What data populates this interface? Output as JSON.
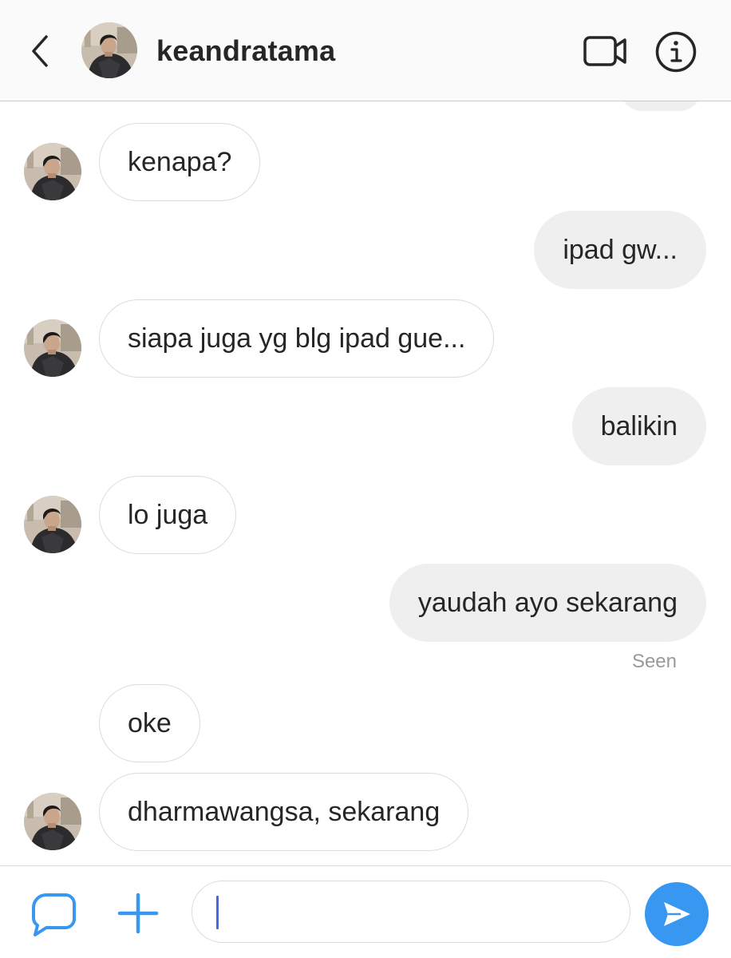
{
  "header": {
    "username": "keandratama",
    "back_icon": "chevron-left-icon",
    "video_icon": "video-camera-icon",
    "info_icon": "info-icon"
  },
  "messages": [
    {
      "sender": "them",
      "text": "kenapa?",
      "avatar": true
    },
    {
      "sender": "me",
      "text": "ipad gw..."
    },
    {
      "sender": "them",
      "text": "siapa juga yg blg ipad gue...",
      "avatar": true
    },
    {
      "sender": "me",
      "text": "balikin"
    },
    {
      "sender": "them",
      "text": "lo juga",
      "avatar": true
    },
    {
      "sender": "me",
      "text": "yaudah ayo sekarang"
    },
    {
      "sender": "them",
      "text": "oke",
      "avatar": false
    },
    {
      "sender": "them",
      "text": "dharmawangsa, sekarang",
      "avatar": true
    }
  ],
  "seen_label": "Seen",
  "composer": {
    "value": "",
    "camera_icon": "camera-icon",
    "plus_icon": "plus-icon",
    "send_icon": "send-icon"
  },
  "colors": {
    "header_bg": "#fafafa",
    "incoming_border": "#dbdbdb",
    "outgoing_bg": "#efefef",
    "accent": "#3897f0",
    "caret": "#3f69e6",
    "seen_text": "#999999"
  }
}
